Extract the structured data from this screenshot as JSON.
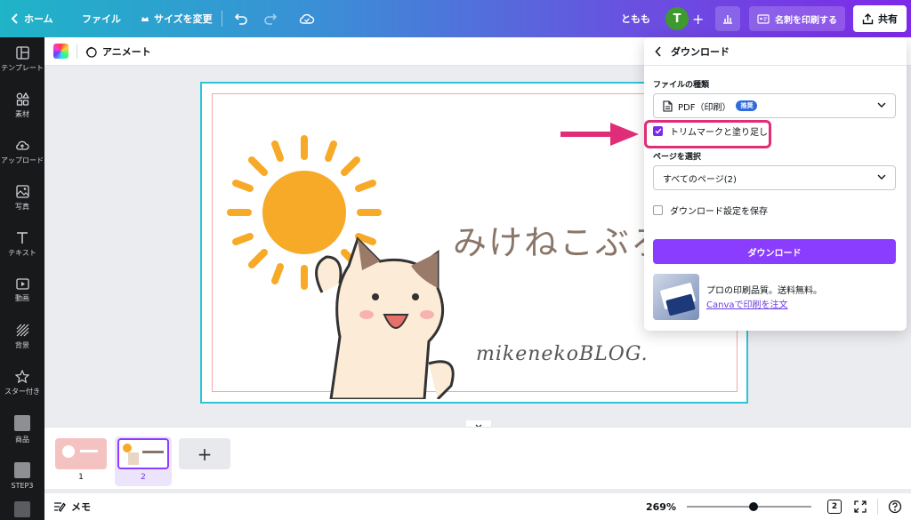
{
  "topbar": {
    "home_label": "ホーム",
    "file_label": "ファイル",
    "resize_label": "サイズを変更",
    "user_name": "ともも",
    "avatar_initial": "T",
    "print_label": "名刺を印刷する",
    "share_label": "共有"
  },
  "rail": {
    "items": [
      {
        "label": "テンプレート",
        "icon": "template-icon"
      },
      {
        "label": "素材",
        "icon": "elements-icon"
      },
      {
        "label": "アップロード",
        "icon": "upload-icon"
      },
      {
        "label": "写真",
        "icon": "photo-icon"
      },
      {
        "label": "テキスト",
        "icon": "text-icon"
      },
      {
        "label": "動画",
        "icon": "video-icon"
      },
      {
        "label": "背景",
        "icon": "background-icon"
      },
      {
        "label": "スター付き",
        "icon": "star-icon"
      },
      {
        "label": "商品",
        "icon": "product-thumb"
      },
      {
        "label": "STEP3",
        "icon": "step3-thumb"
      }
    ]
  },
  "subbar": {
    "animate_label": "アニメート"
  },
  "card": {
    "title": "みけねこぶろ",
    "subtitle": "mikenekoBLOG."
  },
  "pages": {
    "page1": "1",
    "page2": "2",
    "add": "+"
  },
  "footer": {
    "memo_label": "メモ",
    "zoom": "269%",
    "zoom_fraction": 0.5,
    "page_count": "2"
  },
  "download_panel": {
    "title": "ダウンロード",
    "file_type_label": "ファイルの種類",
    "file_type_value": "PDF（印刷）",
    "recommended_badge": "推奨",
    "trim_marks_label": "トリムマークと塗り足し",
    "trim_marks_checked": true,
    "pages_label": "ページを選択",
    "pages_value": "すべてのページ(2)",
    "save_settings_label": "ダウンロード設定を保存",
    "save_settings_checked": false,
    "download_button": "ダウンロード",
    "promo_line1": "プロの印刷品質。送料無料。",
    "promo_link": "Canvaで印刷を注文"
  },
  "colors": {
    "accent": "#8b3dff",
    "highlight": "#e02d78",
    "sun": "#f7a928",
    "canvas_border": "#2ec4d6"
  }
}
